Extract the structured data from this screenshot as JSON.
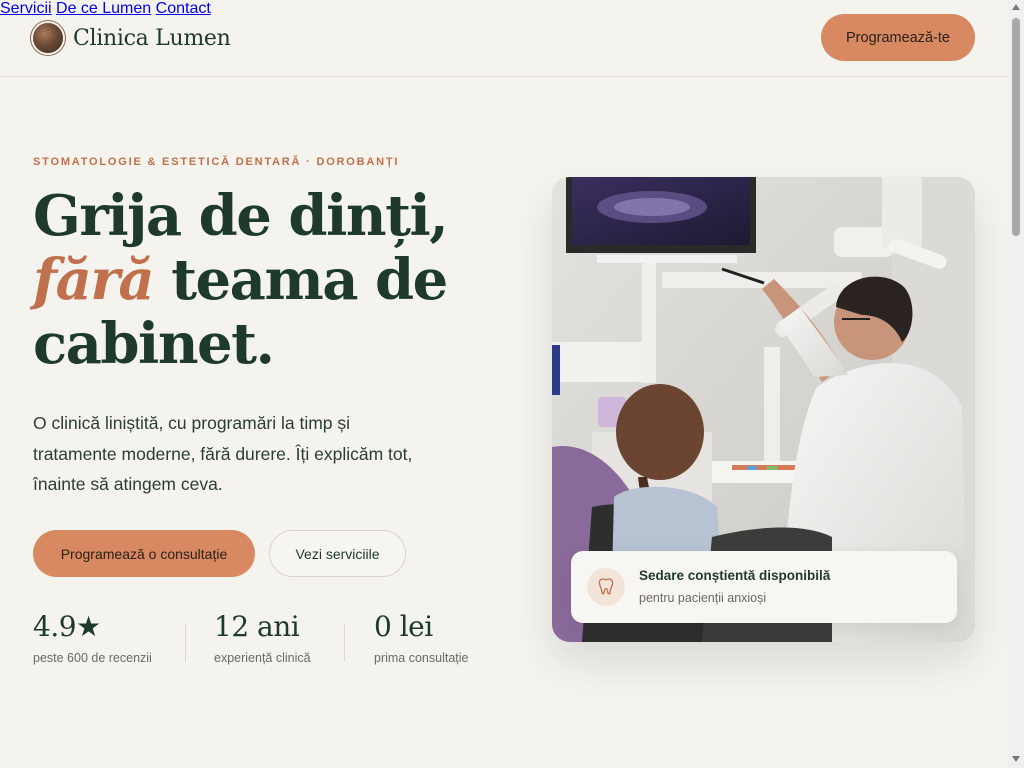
{
  "header": {
    "logo_text": "Clinica Lumen",
    "nav": [
      {
        "label": "Servicii"
      },
      {
        "label": "De ce Lumen"
      },
      {
        "label": "Contact"
      }
    ],
    "cta_label": "Programează-te"
  },
  "hero": {
    "eyebrow": "STOMATOLOGIE & ESTETICĂ DENTARĂ · DOROBANȚI",
    "headline_line1": "Grija de dinți,",
    "headline_accent": "fără",
    "headline_line2_rest": " teama de",
    "headline_line3": "cabinet.",
    "lead": "O clinică liniștită, cu programări la timp și tratamente moderne, fără durere. Îți explicăm tot, înainte să atingem ceva.",
    "primary_cta": "Programează o consultație",
    "secondary_cta": "Vezi serviciile",
    "stats": [
      {
        "value": "4.9★",
        "label": "peste 600 de recenzii"
      },
      {
        "value": "12 ani",
        "label": "experiență clinică"
      },
      {
        "value": "0 lei",
        "label": "prima consultație"
      }
    ],
    "badge": {
      "icon": "tooth-icon",
      "title": "Sedare conștientă disponibilă",
      "subtitle": "pentru pacienții anxioși"
    }
  },
  "colors": {
    "background": "#f5f3ee",
    "primary_dark": "#1d3a2c",
    "accent": "#d98962",
    "accent_text": "#c0704c"
  }
}
